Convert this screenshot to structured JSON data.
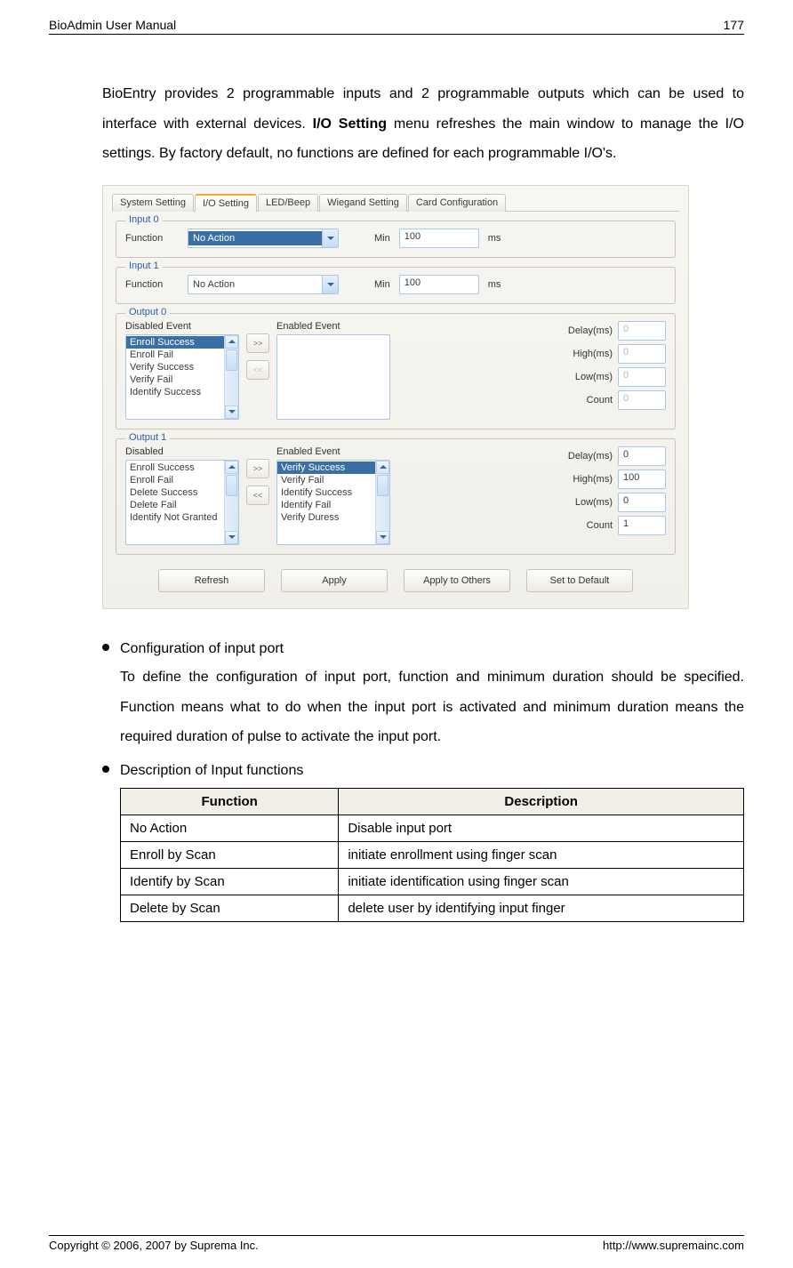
{
  "header": {
    "title": "BioAdmin User Manual",
    "page_no": "177"
  },
  "intro": {
    "p1_a": "BioEntry provides 2 programmable inputs and 2 programmable outputs which can be used to interface with external devices. ",
    "p1_bold": "I/O Setting",
    "p1_b": " menu refreshes the main window to manage the I/O settings. By factory default, no functions are defined for each programmable I/O's."
  },
  "tabs": {
    "t0": "System Setting",
    "t1": "I/O Setting",
    "t2": "LED/Beep",
    "t3": "Wiegand Setting",
    "t4": "Card Configuration"
  },
  "input0": {
    "legend": "Input 0",
    "func_lbl": "Function",
    "func_val": "No Action",
    "min_lbl": "Min",
    "min_val": "100",
    "unit": "ms"
  },
  "input1": {
    "legend": "Input 1",
    "func_lbl": "Function",
    "func_val": "No Action",
    "min_lbl": "Min",
    "min_val": "100",
    "unit": "ms"
  },
  "output0": {
    "legend": "Output 0",
    "dis_lbl": "Disabled Event",
    "en_lbl": "Enabled Event",
    "dis_items": [
      "Enroll Success",
      "Enroll Fail",
      "Verify Success",
      "Verify Fail",
      "Identify Success"
    ],
    "delay_lbl": "Delay(ms)",
    "delay_val": "0",
    "high_lbl": "High(ms)",
    "high_val": "0",
    "low_lbl": "Low(ms)",
    "low_val": "0",
    "count_lbl": "Count",
    "count_val": "0"
  },
  "output1": {
    "legend": "Output 1",
    "dis_lbl": "Disabled",
    "en_lbl": "Enabled Event",
    "dis_items": [
      "Enroll Success",
      "Enroll Fail",
      "Delete Success",
      "Delete Fail",
      "Identify Not Granted"
    ],
    "en_items": [
      "Verify Success",
      "Verify Fail",
      "Identify Success",
      "Identify Fail",
      "Verify Duress"
    ],
    "delay_lbl": "Delay(ms)",
    "delay_val": "0",
    "high_lbl": "High(ms)",
    "high_val": "100",
    "low_lbl": "Low(ms)",
    "low_val": "0",
    "count_lbl": "Count",
    "count_val": "1"
  },
  "buttons": {
    "refresh": "Refresh",
    "apply": "Apply",
    "apply_others": "Apply to Others",
    "set_default": "Set to Default",
    "move_r": ">>",
    "move_l": "<<"
  },
  "bullets": {
    "b1_title": "Configuration of input port",
    "b1_text": "To define the configuration of input port, function and minimum duration should be specified. Function means what to do when the input port is activated and minimum duration means the required duration of pulse to activate the input port.",
    "b2_title": "Description of Input functions"
  },
  "table": {
    "h1": "Function",
    "h2": "Description",
    "rows": [
      {
        "f": "No Action",
        "d": "Disable input port"
      },
      {
        "f": "Enroll by Scan",
        "d": "initiate enrollment using finger scan"
      },
      {
        "f": "Identify by Scan",
        "d": "initiate identification using finger scan"
      },
      {
        "f": "Delete by Scan",
        "d": "delete user by identifying input finger"
      }
    ]
  },
  "footer": {
    "copyright": "Copyright © 2006, 2007 by Suprema Inc.",
    "url": "http://www.supremainc.com"
  }
}
